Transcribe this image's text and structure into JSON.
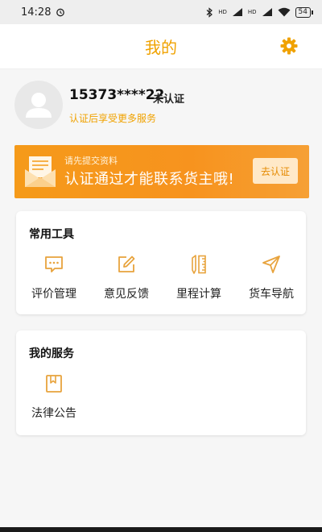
{
  "status_bar": {
    "time": "14:28",
    "battery": "54",
    "signal_label": "HD"
  },
  "header": {
    "title": "我的"
  },
  "profile": {
    "phone": "15373****22",
    "status": "未认证",
    "hint": "认证后享受更多服务"
  },
  "banner": {
    "subtitle": "请先提交资料",
    "title": "认证通过才能联系货主哦!",
    "button_label": "去认证"
  },
  "tools": {
    "title": "常用工具",
    "items": [
      {
        "label": "评价管理",
        "icon": "comment-icon"
      },
      {
        "label": "意见反馈",
        "icon": "edit-icon"
      },
      {
        "label": "里程计算",
        "icon": "ruler-pencil-icon"
      },
      {
        "label": "货车导航",
        "icon": "navigation-icon"
      }
    ]
  },
  "services": {
    "title": "我的服务",
    "items": [
      {
        "label": "法律公告",
        "icon": "bookmark-icon"
      }
    ]
  },
  "colors": {
    "accent": "#f0a200",
    "banner": "#f7931e",
    "icon": "#e8a33d"
  }
}
